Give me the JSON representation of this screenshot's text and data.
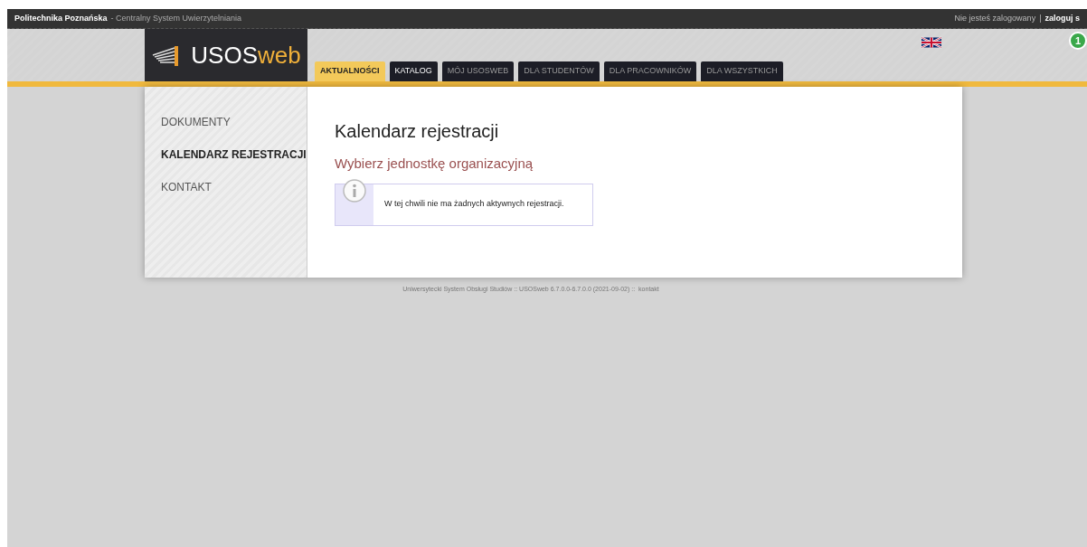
{
  "top_bar": {
    "institution": "Politechnika Poznańska",
    "subtitle": "- Centralny System Uwierzytelniania",
    "status": "Nie jesteś zalogowany",
    "separator": "|",
    "login_link": "zaloguj s"
  },
  "logo": {
    "part_1": "USOS",
    "part_2": "web"
  },
  "badge": "1",
  "tabs": [
    {
      "label": "AKTUALNOŚCI",
      "selected": true
    },
    {
      "label": "KATALOG",
      "selected": false
    },
    {
      "label": "MÓJ USOSWEB",
      "selected": false
    },
    {
      "label": "DLA STUDENTÓW",
      "selected": false
    },
    {
      "label": "DLA PRACOWNIKÓW",
      "selected": false
    },
    {
      "label": "DLA WSZYSTKICH",
      "selected": false
    }
  ],
  "sidebar": {
    "items": [
      {
        "label": "DOKUMENTY",
        "selected": false
      },
      {
        "label": "KALENDARZ REJESTRACJI",
        "selected": true
      },
      {
        "label": "KONTAKT",
        "selected": false
      }
    ]
  },
  "content": {
    "title": "Kalendarz rejestracji",
    "subtitle": "Wybierz jednostkę organizacyjną",
    "info_message": "W tej chwili nie ma żadnych aktywnych rejestracji."
  },
  "footer": {
    "text": "Uniwersytecki System Obsługi Studiów :: USOSweb 6.7.0.0-6.7.0.0 (2021-09-02) ::",
    "link": "kontakt"
  }
}
